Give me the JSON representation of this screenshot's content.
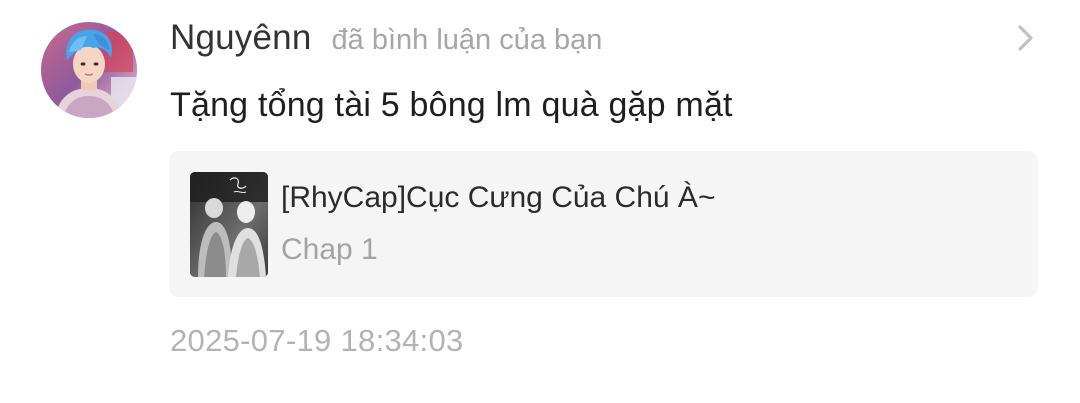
{
  "notification": {
    "user": {
      "name": "Nguyênn",
      "avatar_icon": "user-avatar-photo"
    },
    "action_text": "đã bình luận của bạn",
    "comment_text": "Tặng tổng tài 5 bông lm quà gặp mặt",
    "chevron_icon": "chevron-right-icon",
    "linked_story": {
      "title": "[RhyCap]Cục Cưng Của Chú À~",
      "chapter": "Chap 1",
      "cover_icon": "story-cover-image"
    },
    "timestamp": "2025-07-19 18:34:03"
  },
  "colors": {
    "username": "#333333",
    "secondary_text": "#a6a6a6",
    "card_background": "#f5f5f5",
    "timestamp": "#b3b3b3"
  }
}
